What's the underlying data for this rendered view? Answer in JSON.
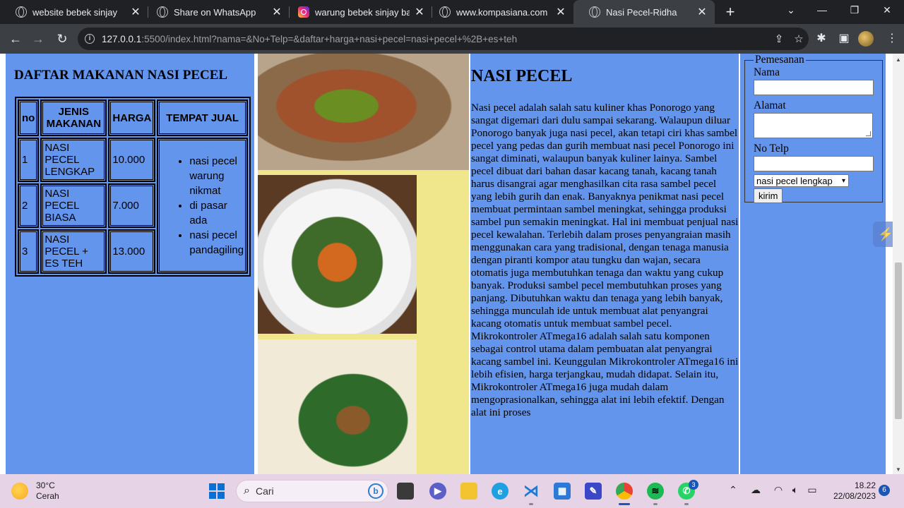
{
  "browser": {
    "tabs": [
      {
        "title": "website bebek sinjay",
        "icon": "globe-icon"
      },
      {
        "title": "Share on WhatsApp",
        "icon": "globe-icon"
      },
      {
        "title": "warung bebek sinjay banc",
        "icon": "instagram-icon"
      },
      {
        "title": "www.kompasiana.com",
        "icon": "globe-icon"
      },
      {
        "title": "Nasi Pecel-Ridha",
        "icon": "globe-icon",
        "active": true
      }
    ],
    "new_tab_label": "+",
    "url_host": "127.0.0.1",
    "url_path": ":5500/index.html?nama=&No+Telp=&daftar+harga+nasi+pecel=nasi+pecel+%2B+es+teh"
  },
  "menu": {
    "title": "DAFTAR MAKANAN NASI PECEL",
    "headers": [
      "no",
      "JENIS MAKANAN",
      "HARGA",
      "TEMPAT JUAL"
    ],
    "rows": [
      {
        "no": "1",
        "name": "NASI PECEL LENGKAP",
        "price": "10.000"
      },
      {
        "no": "2",
        "name": "NASI PECEL BIASA",
        "price": "7.000"
      },
      {
        "no": "3",
        "name": "NASI PECEL + ES TEH",
        "price": "13.000"
      }
    ],
    "sellers": [
      "nasi pecel warung nikmat",
      "di pasar ada",
      "nasi pecel pandagiling"
    ]
  },
  "article": {
    "title": "NASI PECEL",
    "body": "Nasi pecel adalah salah satu kuliner khas Ponorogo yang sangat digemari dari dulu sampai sekarang. Walaupun diluar Ponorogo banyak juga nasi pecel, akan tetapi ciri khas sambel pecel yang pedas dan gurih membuat nasi pecel Ponorogo ini sangat diminati, walaupun banyak kuliner lainya. Sambel pecel dibuat dari bahan dasar kacang tanah, kacang tanah harus disangrai agar menghasilkan cita rasa sambel pecel yang lebih gurih dan enak. Banyaknya penikmat nasi pecel membuat permintaan sambel meningkat, sehingga produksi sambel pun semakin meningkat. Hal ini membuat penjual nasi pecel kewalahan. Terlebih dalam proses penyangraian masih menggunakan cara yang tradisional, dengan tenaga manusia dengan piranti kompor atau tungku dan wajan, secara otomatis juga membutuhkan tenaga dan waktu yang cukup banyak. Produksi sambel pecel membutuhkan proses yang panjang. Dibutuhkan waktu dan tenaga yang lebih banyak, sehingga munculah ide untuk membuat alat penyangrai kacang otomatis untuk membuat sambel pecel. Mikrokontroler ATmega16 adalah salah satu komponen sebagai control utama dalam pembuatan alat penyangrai kacang sambel ini. Keunggulan Mikrokontroler ATmega16 ini lebih efisien, harga terjangkau, mudah didapat. Selain itu, Mikrokontroler ATmega16 juga mudah dalam mengoprasionalkan, sehingga alat ini lebih efektif. Dengan alat ini proses"
  },
  "form": {
    "legend": "Pemesanan",
    "name_label": "Nama",
    "name_value": "",
    "address_label": "Alamat",
    "address_value": "",
    "phone_label": "No Telp",
    "phone_value": "",
    "select_value": "nasi pecel lengkap",
    "submit_label": "kirim"
  },
  "taskbar": {
    "temperature": "30°C",
    "weather": "Cerah",
    "search_placeholder": "Cari",
    "time": "18.22",
    "date": "22/08/2023",
    "notifications": "6",
    "whatsapp_badge": "3"
  }
}
